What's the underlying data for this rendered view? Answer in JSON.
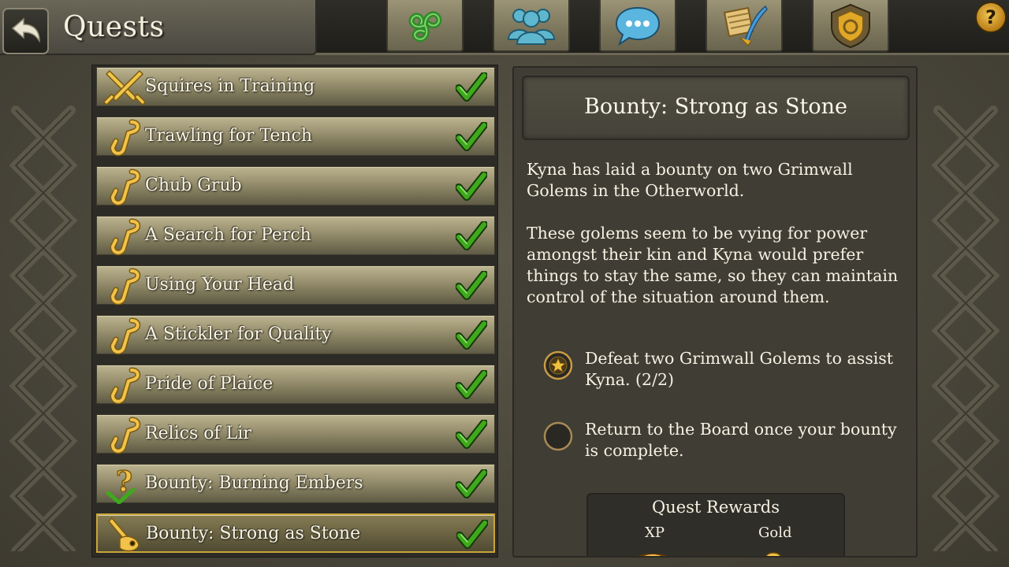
{
  "header": {
    "title": "Quests",
    "tabs": [
      {
        "icon": "triskelion-icon",
        "name": "tab-triskelion"
      },
      {
        "icon": "friends-icon",
        "name": "tab-friends"
      },
      {
        "icon": "chat-icon",
        "name": "tab-chat"
      },
      {
        "icon": "scroll-quill-icon",
        "name": "tab-quests"
      },
      {
        "icon": "guild-crest-icon",
        "name": "tab-guild"
      }
    ],
    "help_label": "?"
  },
  "quests": [
    {
      "label": "Squires in Training",
      "icon": "crossed-swords-icon",
      "completed": true
    },
    {
      "label": "Trawling for Tench",
      "icon": "fish-hook-icon",
      "completed": true
    },
    {
      "label": "Chub Grub",
      "icon": "fish-hook-icon",
      "completed": true
    },
    {
      "label": "A Search for Perch",
      "icon": "fish-hook-icon",
      "completed": true
    },
    {
      "label": "Using Your Head",
      "icon": "fish-hook-icon",
      "completed": true
    },
    {
      "label": "A Stickler for Quality",
      "icon": "fish-hook-icon",
      "completed": true
    },
    {
      "label": "Pride of Plaice",
      "icon": "fish-hook-icon",
      "completed": true
    },
    {
      "label": "Relics of Lir",
      "icon": "fish-hook-icon",
      "completed": true
    },
    {
      "label": "Bounty: Burning Embers",
      "icon": "bounty-question-icon",
      "completed": true
    },
    {
      "label": "Bounty: Strong as Stone",
      "icon": "bounty-sword-icon",
      "completed": true,
      "selected": true
    }
  ],
  "detail": {
    "title": "Bounty: Strong as Stone",
    "paragraph1": "Kyna has laid a bounty on two Grimwall Golems in the Otherworld.",
    "paragraph2": "These golems seem to be vying for power amongst their kin and Kyna would prefer things to stay the same, so they can maintain control of the situation around them.",
    "objectives": [
      {
        "text": "Defeat two Grimwall Golems to assist Kyna. (2/2)",
        "done": true
      },
      {
        "text": "Return to the Board once your bounty is complete.",
        "done": false
      }
    ],
    "rewards": {
      "title": "Quest Rewards",
      "xp_label": "XP",
      "gold_label": "Gold"
    }
  },
  "colors": {
    "check_green": "#3fa91c",
    "gold": "#e0a826",
    "selected_border": "#c9a538"
  }
}
